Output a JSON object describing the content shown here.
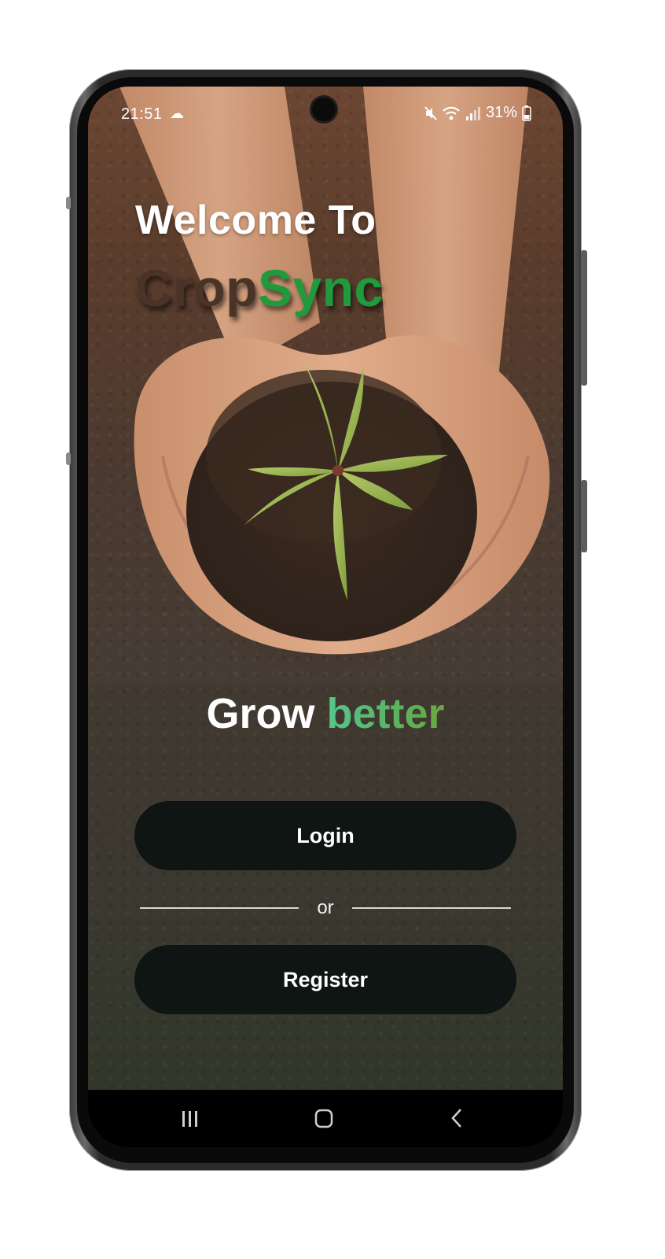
{
  "status_bar": {
    "time": "21:51",
    "battery_percent": "31%",
    "icons": [
      "weather-cloud-icon",
      "mute-icon",
      "wifi-icon",
      "signal-icon",
      "battery-icon"
    ]
  },
  "welcome": {
    "heading": "Welcome To",
    "brand_part1": "Crop",
    "brand_part2": "Sync"
  },
  "tagline": {
    "word1": "Grow",
    "word2": "better"
  },
  "actions": {
    "login_label": "Login",
    "divider_text": "or",
    "register_label": "Register"
  },
  "navigation": {
    "buttons": [
      "recents-icon",
      "home-icon",
      "back-icon"
    ]
  },
  "colors": {
    "brand_green": "#1f9a3d",
    "brand_brown": "#4a3428",
    "button_bg": "#0e1512",
    "tagline_gradient_start": "#58c58a",
    "tagline_gradient_end": "#6aa741"
  }
}
